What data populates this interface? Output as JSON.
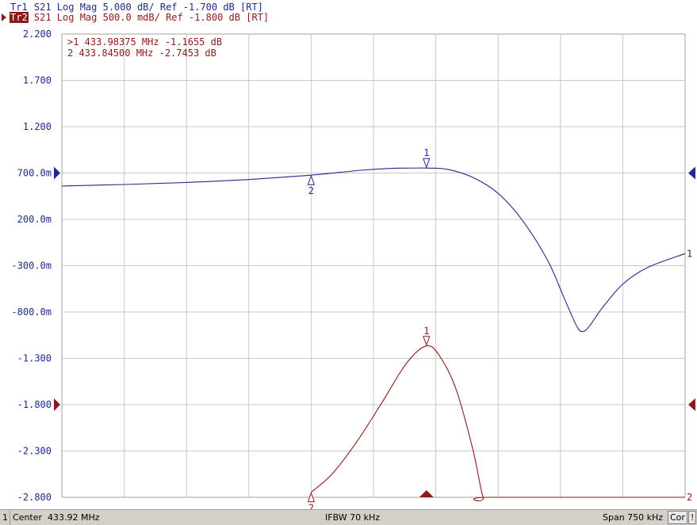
{
  "header": {
    "trace1": {
      "badge": "Tr1",
      "text": " S21 Log Mag 5.000 dB/ Ref -1.700 dB [RT]"
    },
    "trace2": {
      "badge": "Tr2",
      "text": " S21 Log Mag 500.0 mdB/ Ref -1.800 dB [RT]"
    }
  },
  "marker_table": [
    {
      "row": ">1  433.98375 MHz -1.1655 dB"
    },
    {
      "row": " 2  433.84500 MHz -2.7453 dB"
    }
  ],
  "status": {
    "channel": "1",
    "center": "Center  433.92 MHz",
    "ifbw": "IFBW 70 kHz",
    "span": "Span 750 kHz",
    "cor": "Cor",
    "warn": "!"
  },
  "colors": {
    "trace1": "#1f2a8c",
    "trace2": "#8b1a1a",
    "grid": "#c8c8c8",
    "text": "#1f2a8c"
  },
  "chart_data": {
    "type": "line",
    "title": "",
    "xlabel": "",
    "ylabel": "",
    "y_tick_labels": [
      "2.200",
      "1.700",
      "1.200",
      "700.0m",
      "200.0m",
      "-300.0m",
      "-800.0m",
      "-1.300",
      "-1.800",
      "-2.300",
      "-2.800"
    ],
    "ylim": [
      -2.8,
      2.2
    ],
    "x_range_mhz": [
      433.545,
      434.295
    ],
    "grid": true,
    "divisions": 10,
    "series": [
      {
        "scale_db_per_div": 5.0,
        "ref_db": -1.7,
        "ref_position_tick": "700.0m",
        "end_label": "1",
        "x_mhz": [
          433.545,
          433.62,
          433.695,
          433.77,
          433.845,
          433.905,
          433.94,
          433.96,
          433.98375,
          434.01,
          434.04,
          434.07,
          434.1,
          434.13,
          434.15,
          434.165,
          434.1725,
          434.18,
          434.195,
          434.22,
          434.25,
          434.295
        ],
        "y_db": [
          -3.1,
          -2.94,
          -2.72,
          -2.4,
          -1.93,
          -1.4,
          -1.2,
          -1.17,
          -1.1655,
          -1.32,
          -2.2,
          -3.9,
          -6.9,
          -11.2,
          -15.3,
          -18.3,
          -18.8,
          -18.2,
          -16.3,
          -13.7,
          -11.9,
          -10.4
        ]
      },
      {
        "scale_db_per_div": 0.5,
        "ref_db": -1.8,
        "ref_position_tick": "-1.800",
        "end_label": "2",
        "x_mhz": [
          433.845,
          433.87,
          433.9,
          433.93,
          433.96,
          433.98375,
          434.0,
          434.02,
          434.04,
          434.052,
          434.06,
          434.295
        ],
        "y_db": [
          -2.7453,
          -2.55,
          -2.2,
          -1.78,
          -1.35,
          -1.1655,
          -1.28,
          -1.65,
          -2.3,
          -2.8,
          -2.8,
          -2.8
        ]
      }
    ],
    "markers": [
      {
        "trace": 0,
        "label": "1",
        "x_mhz": 433.98375,
        "y_db": -1.1655,
        "direction": "down"
      },
      {
        "trace": 0,
        "label": "2",
        "x_mhz": 433.845,
        "y_db": -1.93,
        "direction": "up"
      },
      {
        "trace": 1,
        "label": "1",
        "x_mhz": 433.98375,
        "y_db": -1.1655,
        "direction": "down"
      },
      {
        "trace": 1,
        "label": "2",
        "x_mhz": 433.845,
        "y_db": -2.7453,
        "direction": "up"
      }
    ]
  }
}
